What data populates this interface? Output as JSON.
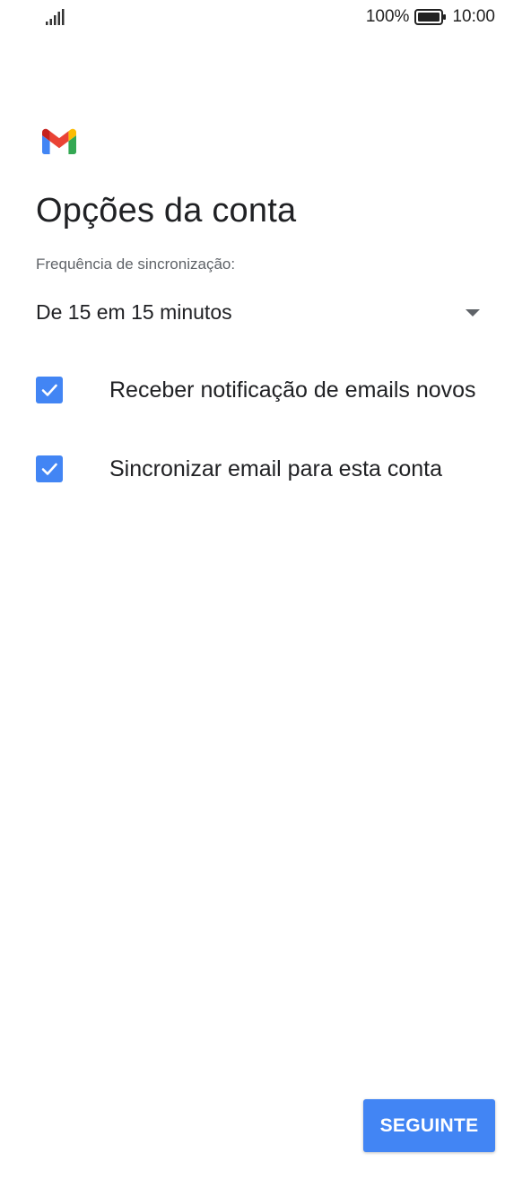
{
  "status_bar": {
    "battery": "100%",
    "time": "10:00",
    "signal_icon": "signal-bars-icon",
    "battery_icon": "battery-full-icon"
  },
  "logo": {
    "icon": "gmail-logo-icon",
    "colors": {
      "blue": "#4285F4",
      "red": "#EA4335",
      "yellow": "#FBBC04",
      "green": "#34A853"
    }
  },
  "page": {
    "title": "Opções da conta",
    "sync_label": "Frequência de sincronização:"
  },
  "sync_frequency": {
    "selected": "De 15 em 15 minutos"
  },
  "options": [
    {
      "label": "Receber notificação de emails novos",
      "checked": true
    },
    {
      "label": "Sincronizar email para esta conta",
      "checked": true
    }
  ],
  "actions": {
    "next_label": "SEGUINTE"
  },
  "colors": {
    "accent": "#4285F4",
    "text": "#202124",
    "secondary_text": "#5F6368"
  }
}
